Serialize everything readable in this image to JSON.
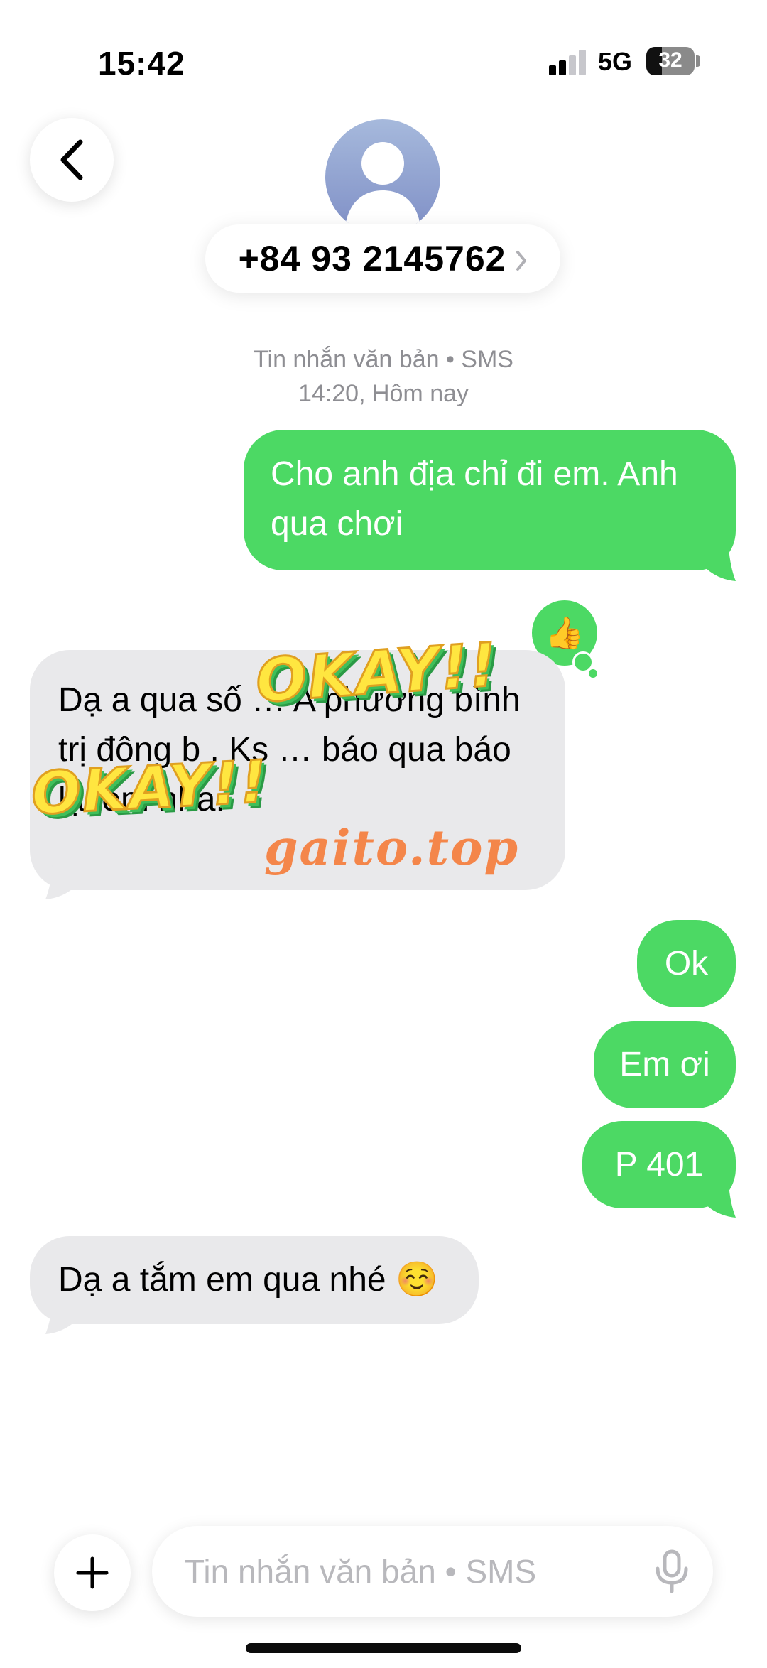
{
  "status_bar": {
    "time": "15:42",
    "network": "5G",
    "battery": "32",
    "battery_level": 0.32
  },
  "header": {
    "contact_number": "+84 93 2145762",
    "chevron": "›"
  },
  "thread": {
    "service_line": "Tin nhắn văn bản • SMS",
    "time_line": "14:20, Hôm nay"
  },
  "messages": [
    {
      "direction": "outgoing",
      "text": "Cho anh địa chỉ đi em. Anh qua chơi"
    },
    {
      "direction": "incoming",
      "text": "Dạ a qua số … A phường bình trị đông b . Ks … báo qua báo lại em nha."
    },
    {
      "direction": "outgoing",
      "text": "Ok"
    },
    {
      "direction": "outgoing",
      "text": "Em ơi"
    },
    {
      "direction": "outgoing",
      "text": "P 401"
    },
    {
      "direction": "incoming",
      "text": "Dạ a tắm em qua nhé ☺️"
    }
  ],
  "reaction": {
    "icon": "thumbs-up-icon",
    "glyph": "👍"
  },
  "overlays": {
    "sticker_1": "OKAY!!",
    "sticker_2": "OKAY!!",
    "watermark": "gaito.top"
  },
  "composer": {
    "placeholder": "Tin nhắn văn bản • SMS",
    "plus_icon": "plus-icon",
    "mic_icon": "microphone-icon"
  },
  "colors": {
    "outgoing_bubble": "#4cd964",
    "incoming_bubble": "#e9e9eb",
    "meta_text": "#8e8e93"
  }
}
